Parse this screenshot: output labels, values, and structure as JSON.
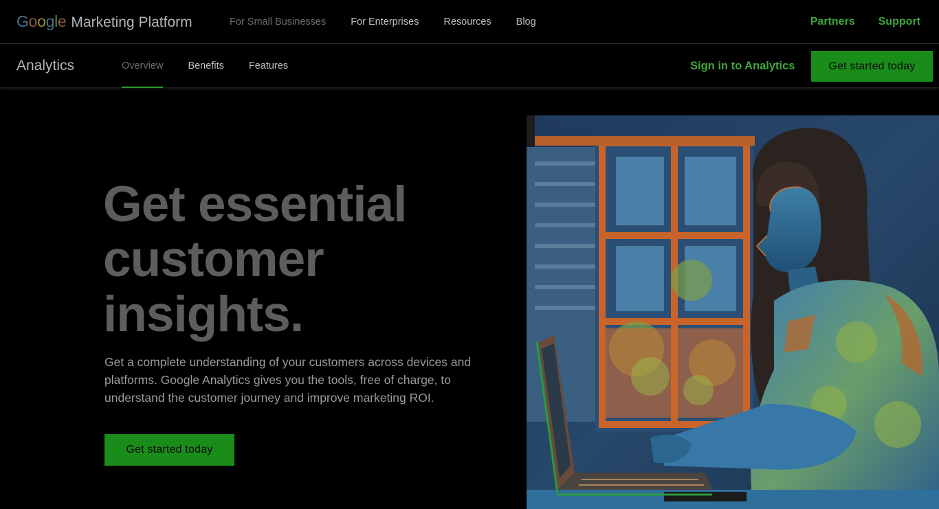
{
  "topbar": {
    "logo_google": [
      "G",
      "o",
      "o",
      "g",
      "l",
      "e"
    ],
    "logo_google_colors": [
      "#4a6f8c",
      "#8c5a3a",
      "#9c8b3a",
      "#4a6f8c",
      "#4d8c45",
      "#8c5a3a"
    ],
    "logo_platform": "Marketing Platform",
    "nav": [
      "For Small Businesses",
      "For Enterprises",
      "Resources",
      "Blog"
    ],
    "right_links": [
      "Partners",
      "Support"
    ]
  },
  "subbar": {
    "product": "Analytics",
    "tabs": [
      "Overview",
      "Benefits",
      "Features"
    ],
    "active_tab": "Overview",
    "sign_in": "Sign in to Analytics",
    "cta": "Get started today"
  },
  "hero": {
    "headline_lines": [
      "Get essential",
      "customer",
      "insights."
    ],
    "description": "Get a complete understanding of your customers across devices and platforms. Google Analytics gives you the tools, free of charge, to understand the customer journey and improve marketing ROI.",
    "cta": "Get started today"
  },
  "colors": {
    "accent_green": "#3fa63a",
    "button_green": "#1a8c1a",
    "background": "#000000"
  }
}
